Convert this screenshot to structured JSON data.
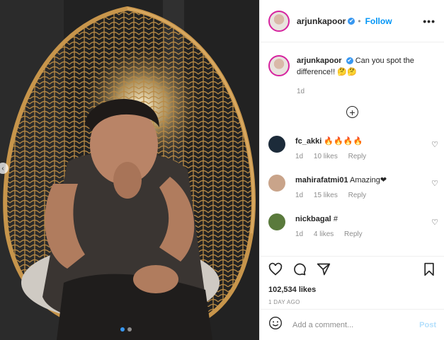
{
  "post": {
    "username": "arjunkapoor",
    "verified_mark": "✔",
    "follow_label": "Follow",
    "more_label": "•••"
  },
  "caption": {
    "username": "arjunkapoor",
    "text": "Can you spot the difference!! 🤔🤔",
    "time": "1d"
  },
  "load_more_label": "+",
  "comments": [
    {
      "username": "fc_akki",
      "text": "🔥🔥🔥🔥",
      "time": "1d",
      "likes": "10 likes",
      "reply": "Reply",
      "avatar_color": "#1c2b3a"
    },
    {
      "username": "mahirafatmi01",
      "text": "Amazing❤",
      "time": "1d",
      "likes": "15 likes",
      "reply": "Reply",
      "avatar_color": "#c9a48a"
    },
    {
      "username": "nickbagal",
      "text": "#",
      "time": "1d",
      "likes": "4 likes",
      "reply": "Reply",
      "avatar_color": "#5a7a3c"
    }
  ],
  "stats": {
    "likes": "102,534 likes",
    "date": "1 DAY AGO"
  },
  "add_comment": {
    "placeholder": "Add a comment...",
    "post_label": "Post"
  },
  "icons": [
    "heart-icon",
    "comment-icon",
    "share-icon",
    "bookmark-icon",
    "emoji-icon",
    "more-icon"
  ],
  "colors": {
    "accent": "#0095f6",
    "verified": "#3897f0",
    "muted": "#8e8e8e"
  }
}
